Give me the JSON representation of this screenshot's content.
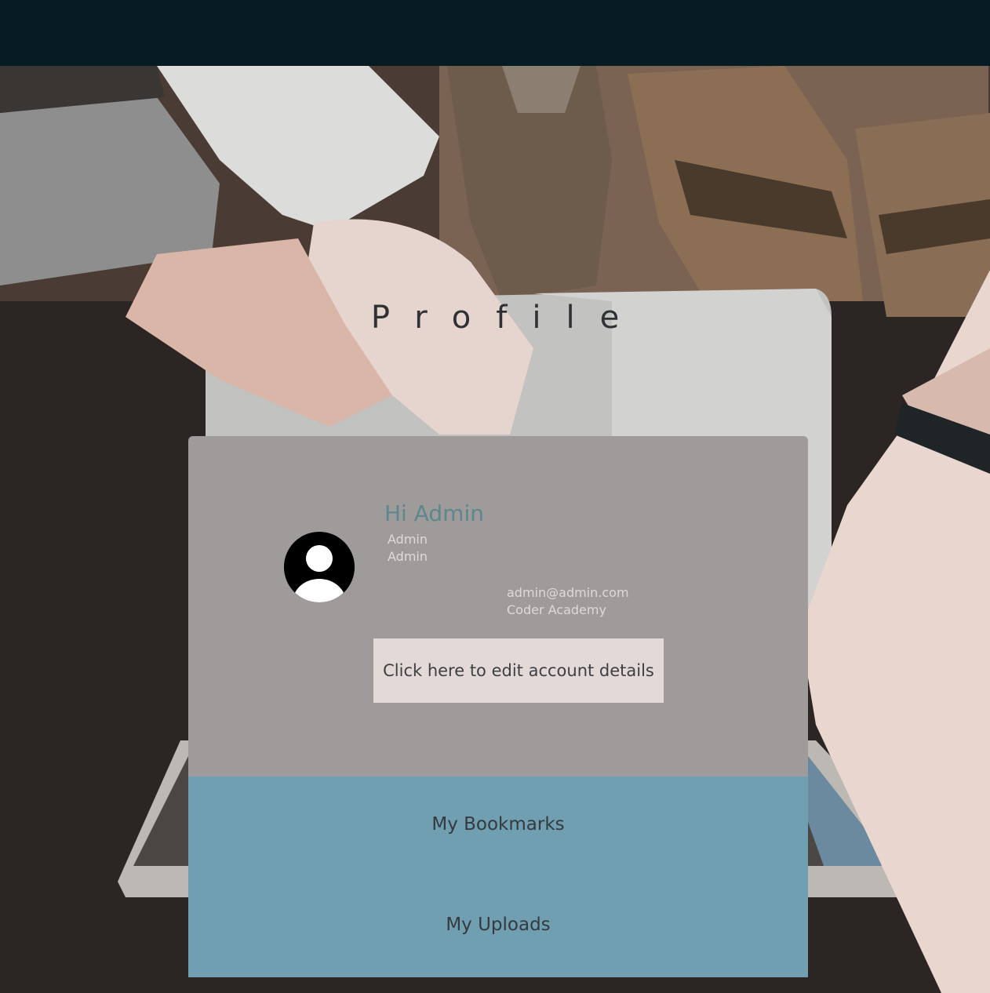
{
  "header": {
    "background_color": "#061c22"
  },
  "hero": {
    "title": "Profile"
  },
  "profile": {
    "greeting": "Hi Admin",
    "first_name": "Admin",
    "last_name": "Admin",
    "email": "admin@admin.com",
    "organization": "Coder Academy",
    "avatar_icon": "user-avatar-icon",
    "edit_button_label": "Click here to edit account details"
  },
  "links": {
    "bookmarks_label": "My Bookmarks",
    "uploads_label": "My Uploads"
  },
  "colors": {
    "card_top": "#9f9b9a",
    "card_bottom": "#6f9fb1",
    "greeting": "#5e878c",
    "button_bg": "#e3dad8"
  }
}
